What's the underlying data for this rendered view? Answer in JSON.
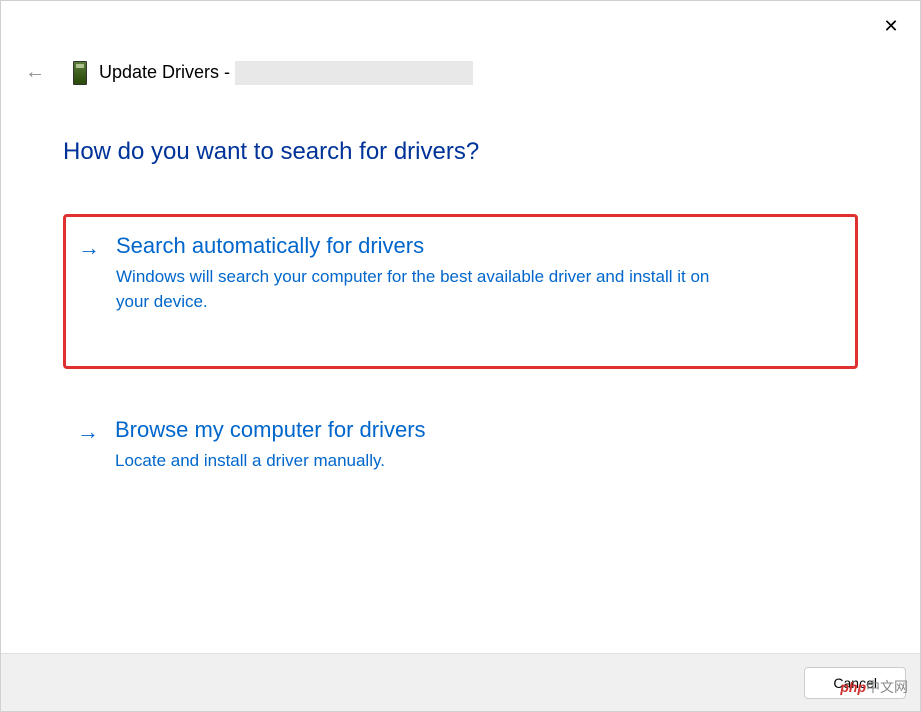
{
  "window": {
    "title_prefix": "Update Drivers -",
    "close_label": "✕"
  },
  "heading": "How do you want to search for drivers?",
  "options": [
    {
      "title": "Search automatically for drivers",
      "description": "Windows will search your computer for the best available driver and install it on your device."
    },
    {
      "title": "Browse my computer for drivers",
      "description": "Locate and install a driver manually."
    }
  ],
  "footer": {
    "cancel_label": "Cancel"
  },
  "watermark": {
    "brand": "php",
    "suffix": "中文网"
  }
}
